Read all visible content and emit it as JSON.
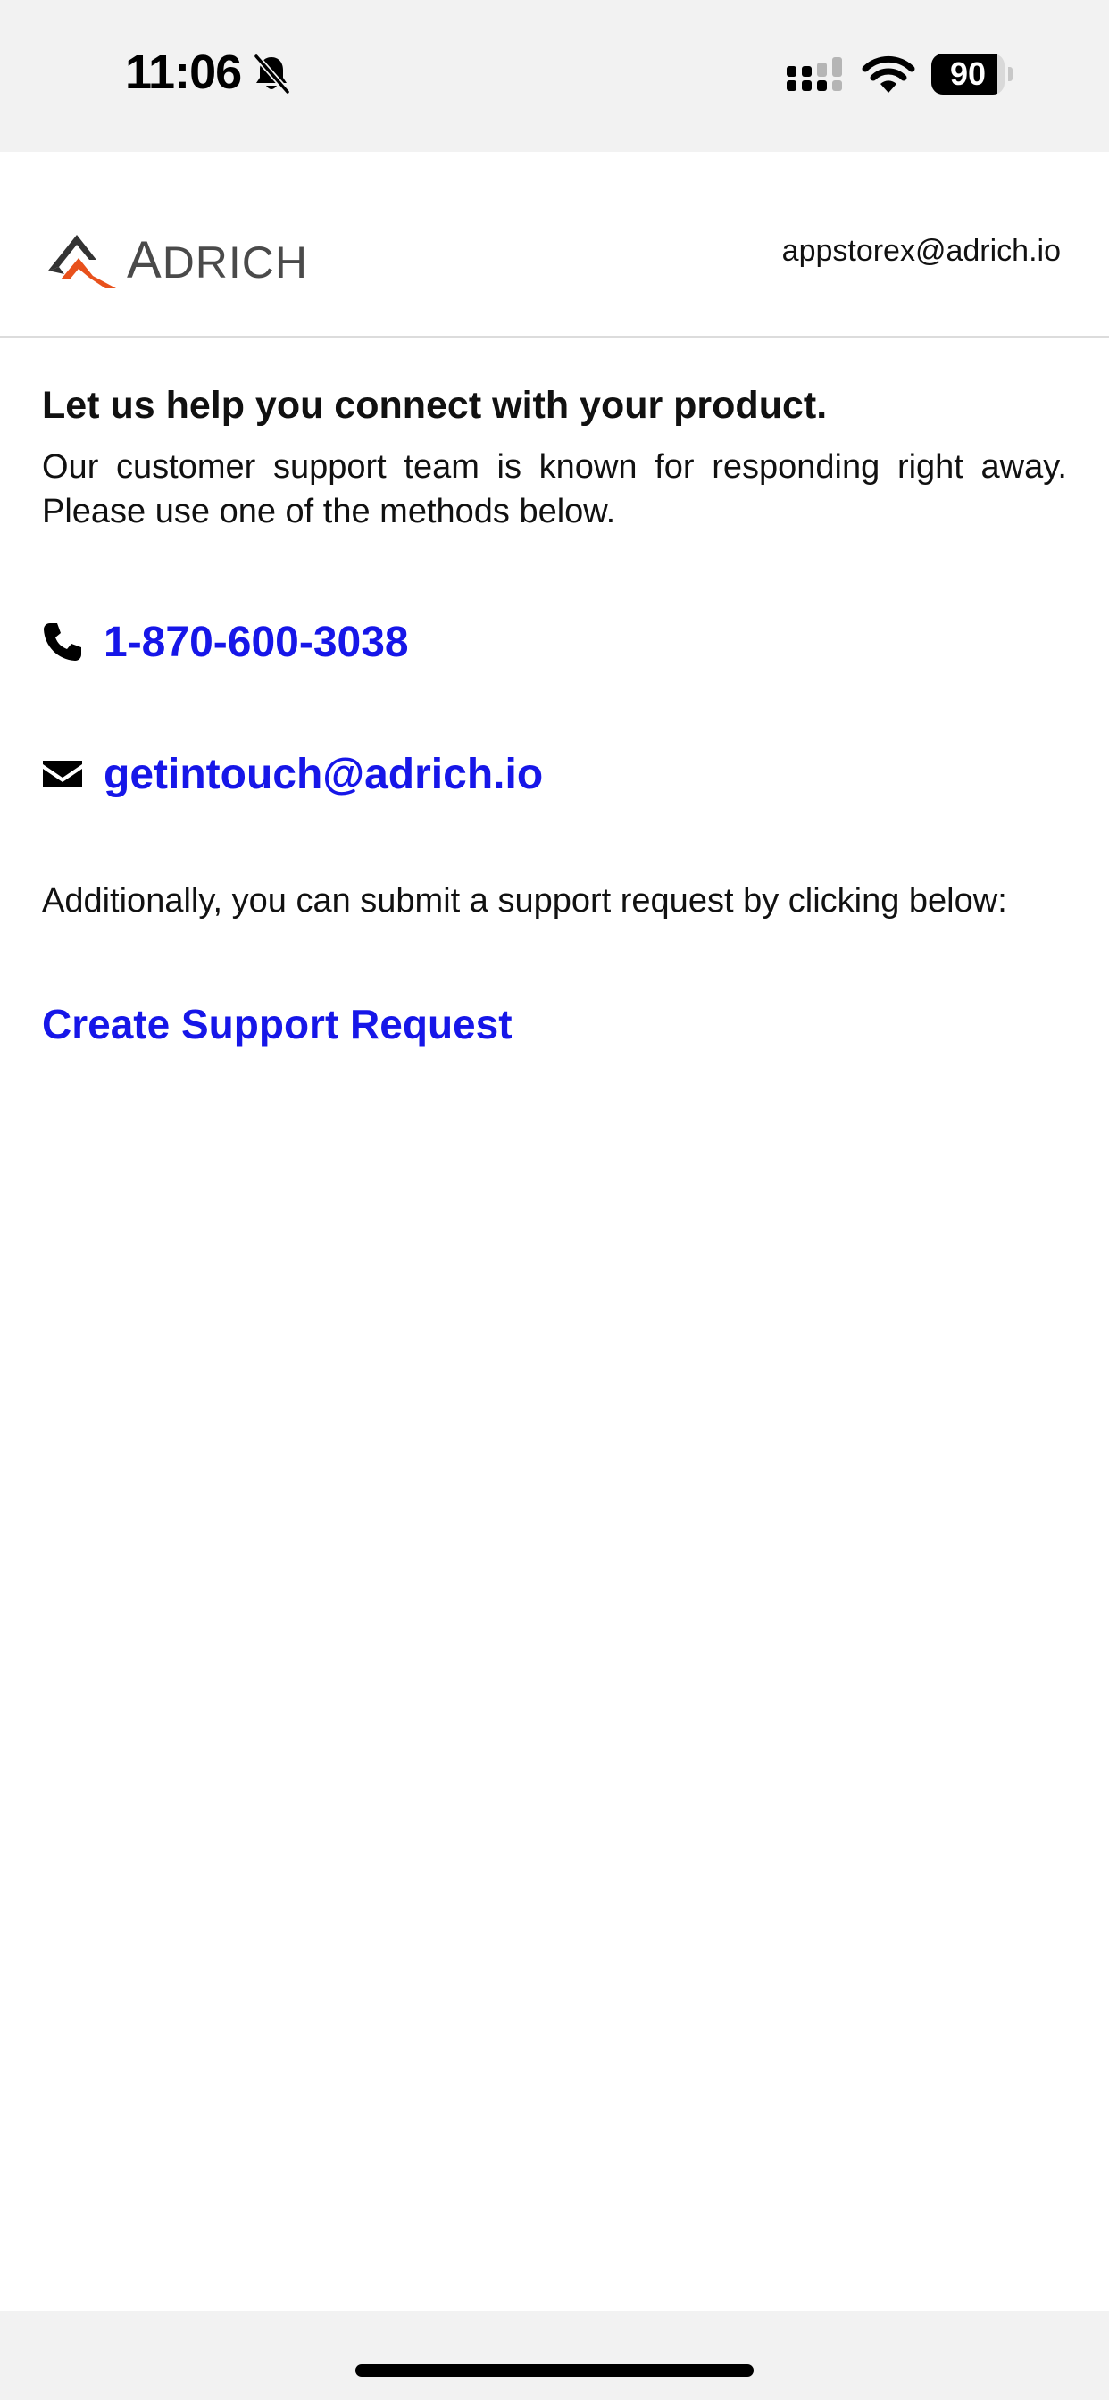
{
  "status_bar": {
    "time": "11:06",
    "battery_percent": "90",
    "battery_level": 0.9,
    "icons": [
      "bell-slash-icon",
      "cellular-signal-icon",
      "wifi-icon",
      "battery-icon"
    ]
  },
  "header": {
    "logo_initial": "A",
    "logo_rest": "DRICH",
    "user_email": "appstorex@adrich.io"
  },
  "main": {
    "headline": "Let us help you connect with your product.",
    "intro": "Our customer support team is known for responding right away. Please use one of the methods below.",
    "phone": {
      "icon": "phone-icon",
      "label": "1-870-600-3038"
    },
    "email": {
      "icon": "envelope-icon",
      "label": "getintouch@adrich.io"
    },
    "additional": "Additionally, you can submit a support request by clicking below:",
    "support_link": "Create Support Request"
  },
  "colors": {
    "link": "#1616e8",
    "logo_dark": "#4a4a4a",
    "logo_accent": "#e8511c",
    "bar_background": "#f2f2f2"
  }
}
